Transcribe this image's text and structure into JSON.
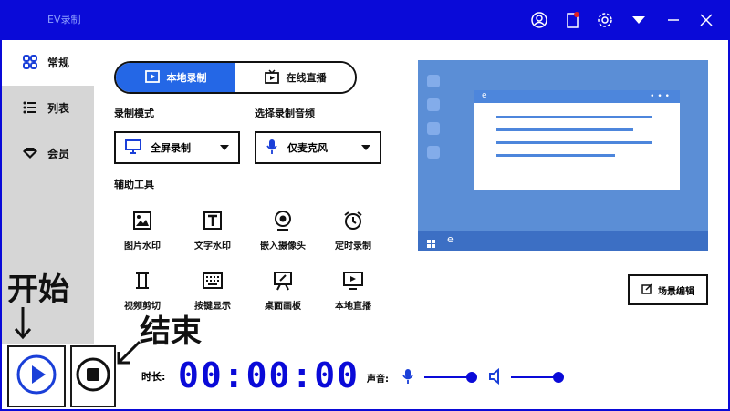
{
  "titlebar": {
    "title": "EV录制",
    "icons": [
      "user-icon",
      "notification-icon",
      "settings-icon",
      "dropdown-icon",
      "minimize-icon",
      "close-icon"
    ]
  },
  "sidebar": {
    "items": [
      {
        "label": "常规",
        "icon": "grid-icon"
      },
      {
        "label": "列表",
        "icon": "list-icon"
      },
      {
        "label": "会员",
        "icon": "diamond-icon"
      }
    ]
  },
  "mode_tabs": [
    {
      "label": "本地录制",
      "active": true
    },
    {
      "label": "在线直播",
      "active": false
    }
  ],
  "record_mode": {
    "label": "录制模式",
    "value": "全屏录制"
  },
  "audio_source": {
    "label": "选择录制音频",
    "value": "仅麦克风"
  },
  "tools_label": "辅助工具",
  "tools": [
    {
      "label": "图片水印",
      "icon": "image-icon"
    },
    {
      "label": "文字水印",
      "icon": "text-icon"
    },
    {
      "label": "嵌入摄像头",
      "icon": "webcam-icon"
    },
    {
      "label": "定时录制",
      "icon": "alarm-icon"
    },
    {
      "label": "视频剪切",
      "icon": "cut-icon"
    },
    {
      "label": "按键显示",
      "icon": "keyboard-icon"
    },
    {
      "label": "桌面画板",
      "icon": "whiteboard-icon"
    },
    {
      "label": "本地直播",
      "icon": "broadcast-icon"
    }
  ],
  "scene_button": "场景编辑",
  "bottom": {
    "duration_label": "时长:",
    "timer": "00:00:00",
    "volume_label": "声音:"
  },
  "volume": {
    "mic_level": 1.0,
    "speaker_level": 1.0
  },
  "annotations": {
    "start": "开始",
    "stop": "结束"
  },
  "colors": {
    "primary": "#0a0ad8",
    "tab_active": "#2467e6",
    "preview_bg": "#5b8ed6"
  }
}
